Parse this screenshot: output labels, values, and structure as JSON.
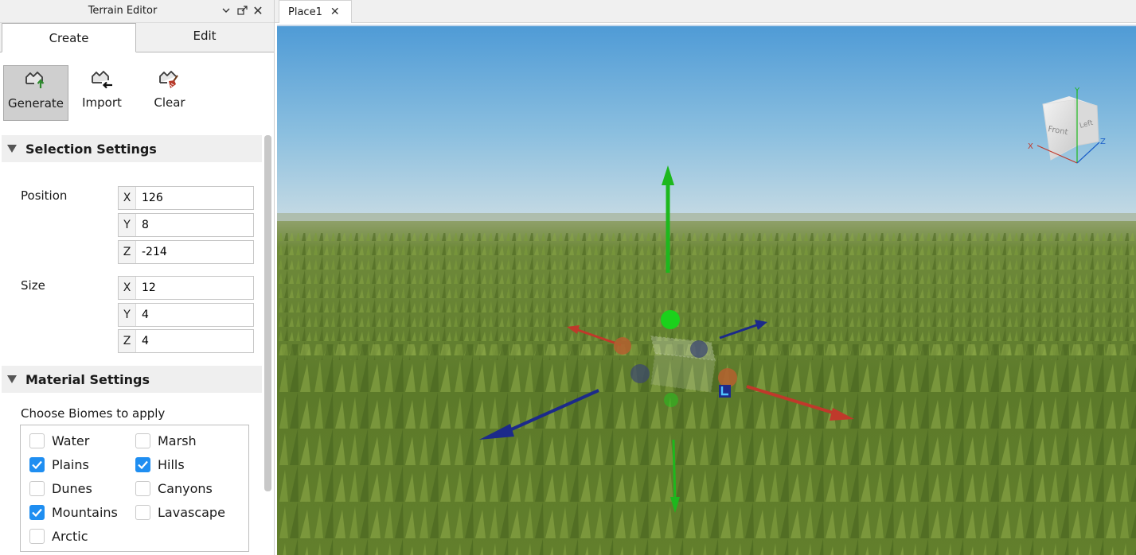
{
  "panel": {
    "title": "Terrain Editor",
    "tabs": [
      {
        "label": "Create",
        "active": true
      },
      {
        "label": "Edit",
        "active": false
      }
    ],
    "tools": [
      {
        "label": "Generate",
        "icon": "terrain-generate-icon",
        "selected": true
      },
      {
        "label": "Import",
        "icon": "terrain-import-icon",
        "selected": false
      },
      {
        "label": "Clear",
        "icon": "terrain-clear-icon",
        "selected": false
      }
    ]
  },
  "selection": {
    "header": "Selection Settings",
    "position": {
      "label": "Position",
      "x": "126",
      "y": "8",
      "z": "-214"
    },
    "size": {
      "label": "Size",
      "x": "12",
      "y": "4",
      "z": "4"
    },
    "axes": {
      "x": "X",
      "y": "Y",
      "z": "Z"
    }
  },
  "material": {
    "header": "Material Settings",
    "biomes_label": "Choose Biomes to apply",
    "biomes": [
      {
        "label": "Water",
        "checked": false
      },
      {
        "label": "Marsh",
        "checked": false
      },
      {
        "label": "Plains",
        "checked": true
      },
      {
        "label": "Hills",
        "checked": true
      },
      {
        "label": "Dunes",
        "checked": false
      },
      {
        "label": "Canyons",
        "checked": false
      },
      {
        "label": "Mountains",
        "checked": true
      },
      {
        "label": "Lavascape",
        "checked": false
      },
      {
        "label": "Arctic",
        "checked": false
      }
    ]
  },
  "document": {
    "tab_label": "Place1"
  },
  "view_cube": {
    "front": "Front",
    "left": "Left",
    "axis_x": "X",
    "axis_y": "Y",
    "axis_z": "Z"
  },
  "colors": {
    "accent": "#1f8ef1",
    "sky_top": "#4f9bd6",
    "sky_horizon": "#c7dbe4",
    "grass": "#5c7a2a",
    "handle_x": "#c0392b",
    "handle_y": "#1db81d",
    "handle_z": "#1c2a8a"
  }
}
